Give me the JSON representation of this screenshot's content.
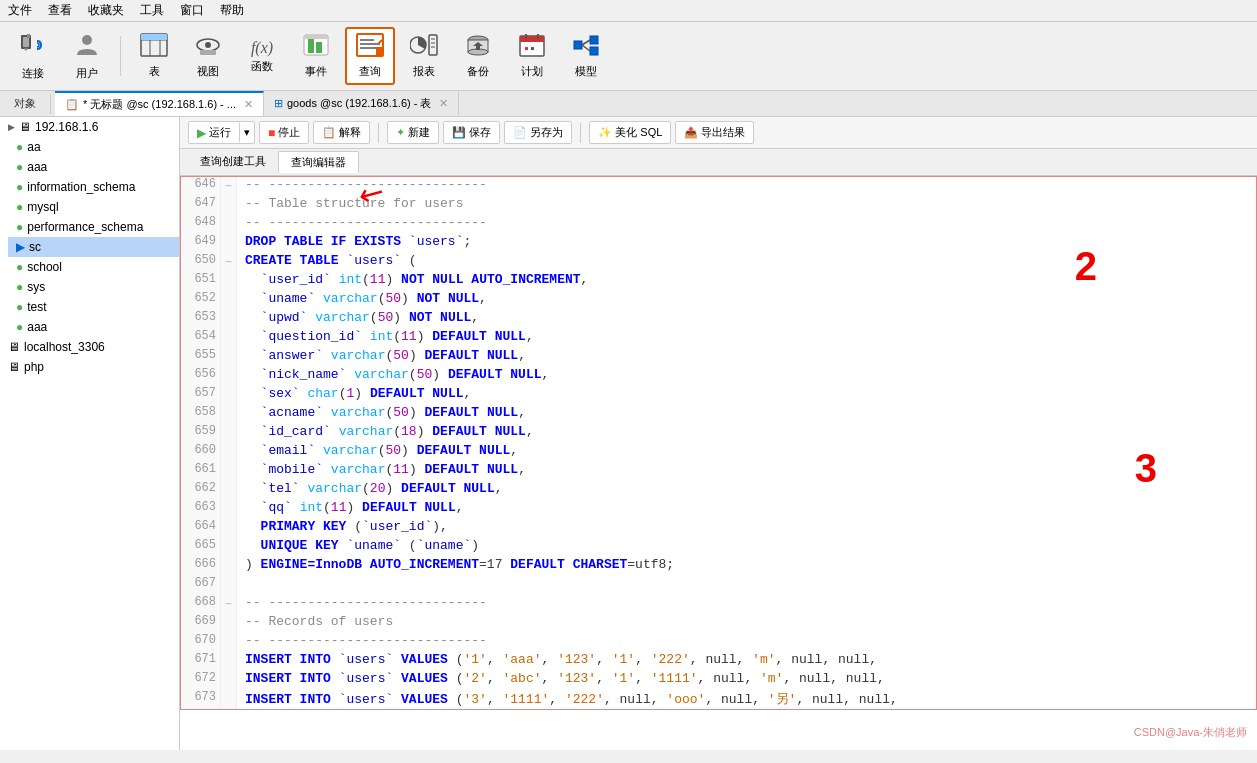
{
  "menubar": {
    "items": [
      "文件",
      "查看",
      "收藏夹",
      "工具",
      "窗口",
      "帮助"
    ]
  },
  "toolbar": {
    "buttons": [
      {
        "id": "connect",
        "label": "连接",
        "icon": "🔌"
      },
      {
        "id": "user",
        "label": "用户",
        "icon": "👤"
      },
      {
        "id": "table",
        "label": "表",
        "icon": "⊞",
        "active": false
      },
      {
        "id": "view",
        "label": "视图",
        "icon": "👓"
      },
      {
        "id": "function",
        "label": "函数",
        "icon": "f(x)"
      },
      {
        "id": "event",
        "label": "事件",
        "icon": "⚡"
      },
      {
        "id": "query",
        "label": "查询",
        "icon": "📋",
        "active": true
      },
      {
        "id": "report",
        "label": "报表",
        "icon": "📊"
      },
      {
        "id": "backup",
        "label": "备份",
        "icon": "💾"
      },
      {
        "id": "schedule",
        "label": "计划",
        "icon": "📅"
      },
      {
        "id": "model",
        "label": "模型",
        "icon": "🔷"
      }
    ]
  },
  "tabbar": {
    "object_label": "对象",
    "tabs": [
      {
        "id": "query-tab",
        "label": "* 无标题 @sc (192.168.1.6) - ...",
        "active": true
      },
      {
        "id": "goods-tab",
        "label": "goods @sc (192.168.1.6) - 表",
        "active": false
      }
    ]
  },
  "action_bar": {
    "run_label": "运行",
    "stop_label": "停止",
    "explain_label": "解释",
    "new_label": "新建",
    "save_label": "保存",
    "save_as_label": "另存为",
    "beautify_label": "美化 SQL",
    "export_label": "导出结果"
  },
  "query_tabs": {
    "builder_label": "查询创建工具",
    "editor_label": "查询编辑器"
  },
  "sidebar": {
    "server": "192.168.1.6",
    "databases": [
      {
        "name": "aa",
        "selected": false
      },
      {
        "name": "aaa",
        "selected": false
      },
      {
        "name": "information_schema",
        "selected": false
      },
      {
        "name": "mysql",
        "selected": false
      },
      {
        "name": "performance_schema",
        "selected": false
      },
      {
        "name": "sc",
        "selected": true
      },
      {
        "name": "school",
        "selected": false
      },
      {
        "name": "sys",
        "selected": false
      },
      {
        "name": "test",
        "selected": false
      },
      {
        "name": "aaa",
        "selected": false
      }
    ],
    "other_servers": [
      {
        "name": "localhost_3306"
      },
      {
        "name": "php"
      }
    ]
  },
  "code_lines": [
    {
      "num": "646",
      "gutter": "─",
      "content": "-- ----------------------------"
    },
    {
      "num": "647",
      "gutter": "",
      "content": "-- Table structure for users"
    },
    {
      "num": "648",
      "gutter": "",
      "content": "-- ----------------------------"
    },
    {
      "num": "649",
      "gutter": "",
      "content": "DROP TABLE IF EXISTS `users`;"
    },
    {
      "num": "650",
      "gutter": "─",
      "content": "CREATE TABLE `users` ("
    },
    {
      "num": "651",
      "gutter": "",
      "content": "  `user_id` int(11) NOT NULL AUTO_INCREMENT,"
    },
    {
      "num": "652",
      "gutter": "",
      "content": "  `uname` varchar(50) NOT NULL,"
    },
    {
      "num": "653",
      "gutter": "",
      "content": "  `upwd` varchar(50) NOT NULL,"
    },
    {
      "num": "654",
      "gutter": "",
      "content": "  `question_id` int(11) DEFAULT NULL,"
    },
    {
      "num": "655",
      "gutter": "",
      "content": "  `answer` varchar(50) DEFAULT NULL,"
    },
    {
      "num": "656",
      "gutter": "",
      "content": "  `nick_name` varchar(50) DEFAULT NULL,"
    },
    {
      "num": "657",
      "gutter": "",
      "content": "  `sex` char(1) DEFAULT NULL,"
    },
    {
      "num": "658",
      "gutter": "",
      "content": "  `acname` varchar(50) DEFAULT NULL,"
    },
    {
      "num": "659",
      "gutter": "",
      "content": "  `id_card` varchar(18) DEFAULT NULL,"
    },
    {
      "num": "660",
      "gutter": "",
      "content": "  `email` varchar(50) DEFAULT NULL,"
    },
    {
      "num": "661",
      "gutter": "",
      "content": "  `mobile` varchar(11) DEFAULT NULL,"
    },
    {
      "num": "662",
      "gutter": "",
      "content": "  `tel` varchar(20) DEFAULT NULL,"
    },
    {
      "num": "663",
      "gutter": "",
      "content": "  `qq` int(11) DEFAULT NULL,"
    },
    {
      "num": "664",
      "gutter": "",
      "content": "  PRIMARY KEY (`user_id`),"
    },
    {
      "num": "665",
      "gutter": "",
      "content": "  UNIQUE KEY `uname` (`uname`)"
    },
    {
      "num": "666",
      "gutter": "",
      "content": ") ENGINE=InnoDB AUTO_INCREMENT=17 DEFAULT CHARSET=utf8;"
    },
    {
      "num": "667",
      "gutter": "",
      "content": ""
    },
    {
      "num": "668",
      "gutter": "─",
      "content": "-- ----------------------------"
    },
    {
      "num": "669",
      "gutter": "",
      "content": "-- Records of users"
    },
    {
      "num": "670",
      "gutter": "",
      "content": "-- ----------------------------"
    },
    {
      "num": "671",
      "gutter": "",
      "content": "INSERT INTO `users` VALUES ('1', 'aaa', '123', '1', '222', null, 'm', null, null,"
    },
    {
      "num": "672",
      "gutter": "",
      "content": "INSERT INTO `users` VALUES ('2', 'abc', '123', '1', '1111', null, 'm', null, null,"
    },
    {
      "num": "673",
      "gutter": "",
      "content": "INSERT INTO `users` VALUES ('3', '1111', '222', null, 'ooo', null, '另', null, null,"
    }
  ],
  "watermark": "CSDN@Java-朱俏老师"
}
